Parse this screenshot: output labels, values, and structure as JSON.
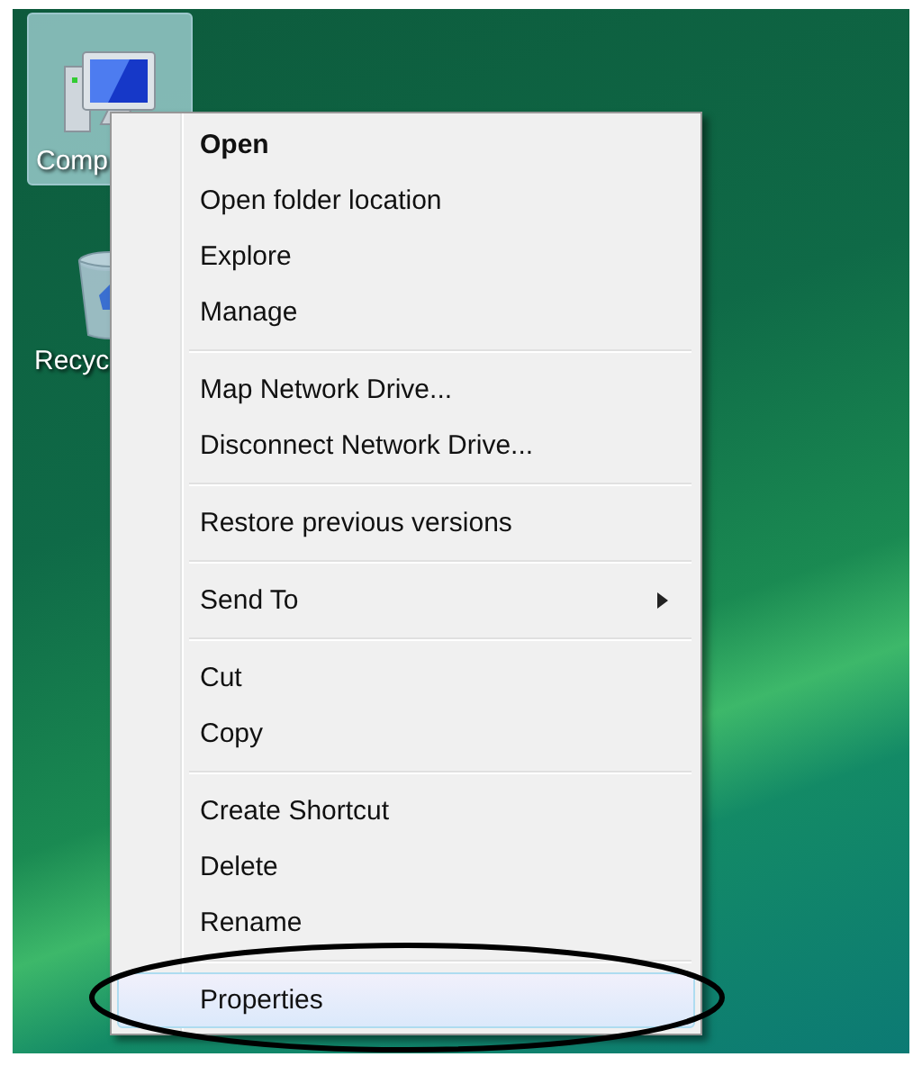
{
  "desktop_icons": [
    {
      "label": "Comp",
      "kind": "computer",
      "selected": true
    },
    {
      "label": "Recyc",
      "kind": "recycle-bin",
      "selected": false
    }
  ],
  "context_menu": {
    "groups": [
      {
        "items": [
          {
            "label": "Open",
            "bold": true,
            "submenu": false,
            "selected": false
          },
          {
            "label": "Open folder location",
            "bold": false,
            "submenu": false,
            "selected": false
          },
          {
            "label": "Explore",
            "bold": false,
            "submenu": false,
            "selected": false
          },
          {
            "label": "Manage",
            "bold": false,
            "submenu": false,
            "selected": false
          }
        ]
      },
      {
        "items": [
          {
            "label": "Map Network Drive...",
            "bold": false,
            "submenu": false,
            "selected": false
          },
          {
            "label": "Disconnect Network Drive...",
            "bold": false,
            "submenu": false,
            "selected": false
          }
        ]
      },
      {
        "items": [
          {
            "label": "Restore previous versions",
            "bold": false,
            "submenu": false,
            "selected": false
          }
        ]
      },
      {
        "items": [
          {
            "label": "Send To",
            "bold": false,
            "submenu": true,
            "selected": false
          }
        ]
      },
      {
        "items": [
          {
            "label": "Cut",
            "bold": false,
            "submenu": false,
            "selected": false
          },
          {
            "label": "Copy",
            "bold": false,
            "submenu": false,
            "selected": false
          }
        ]
      },
      {
        "items": [
          {
            "label": "Create Shortcut",
            "bold": false,
            "submenu": false,
            "selected": false
          },
          {
            "label": "Delete",
            "bold": false,
            "submenu": false,
            "selected": false
          },
          {
            "label": "Rename",
            "bold": false,
            "submenu": false,
            "selected": false
          }
        ]
      },
      {
        "items": [
          {
            "label": "Properties",
            "bold": false,
            "submenu": false,
            "selected": true
          }
        ]
      }
    ]
  },
  "annotation": {
    "kind": "ellipse"
  }
}
